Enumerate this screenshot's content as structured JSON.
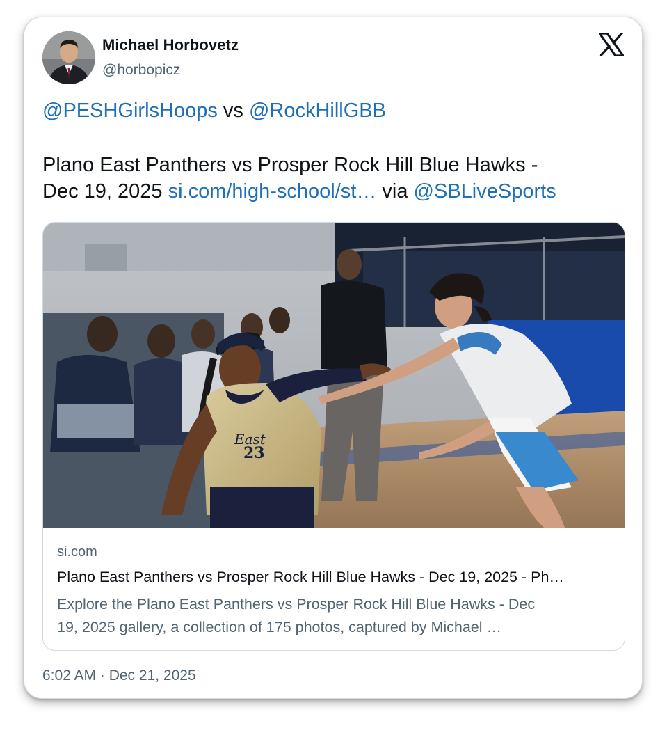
{
  "author": {
    "name": "Michael Horbovetz",
    "handle": "@horbopicz",
    "avatar_icon": "profile-photo"
  },
  "platform": {
    "logo_icon": "x-logo"
  },
  "tweet": {
    "mention_1": "@PESHGirlsHoops",
    "vs_text": " vs ",
    "mention_2": "@RockHillGBB",
    "line_2": "Plano East Panthers vs Prosper Rock Hill Blue Hawks -",
    "line_3_prefix": "Dec 19, 2025 ",
    "link": "si.com/high-school/st…",
    "via_text": " via ",
    "mention_3": "@SBLiveSports"
  },
  "link_card": {
    "image_alt": "Two high school girls basketball players, one in gold jersey #23 and one in white and blue, in a gym with spectators",
    "domain": "si.com",
    "title": "Plano East Panthers vs Prosper Rock Hill Blue Hawks - Dec 19, 2025 - Ph…",
    "description_line_1": "Explore the Plano East Panthers vs Prosper Rock Hill Blue Hawks - Dec",
    "description_line_2": "19, 2025 gallery, a collection of 175 photos, captured by Michael …"
  },
  "timestamp": "6:02 AM · Dec 21, 2025",
  "colors": {
    "link": "#1d6fb8",
    "secondary_text": "#536471",
    "primary_text": "#0f1419"
  }
}
